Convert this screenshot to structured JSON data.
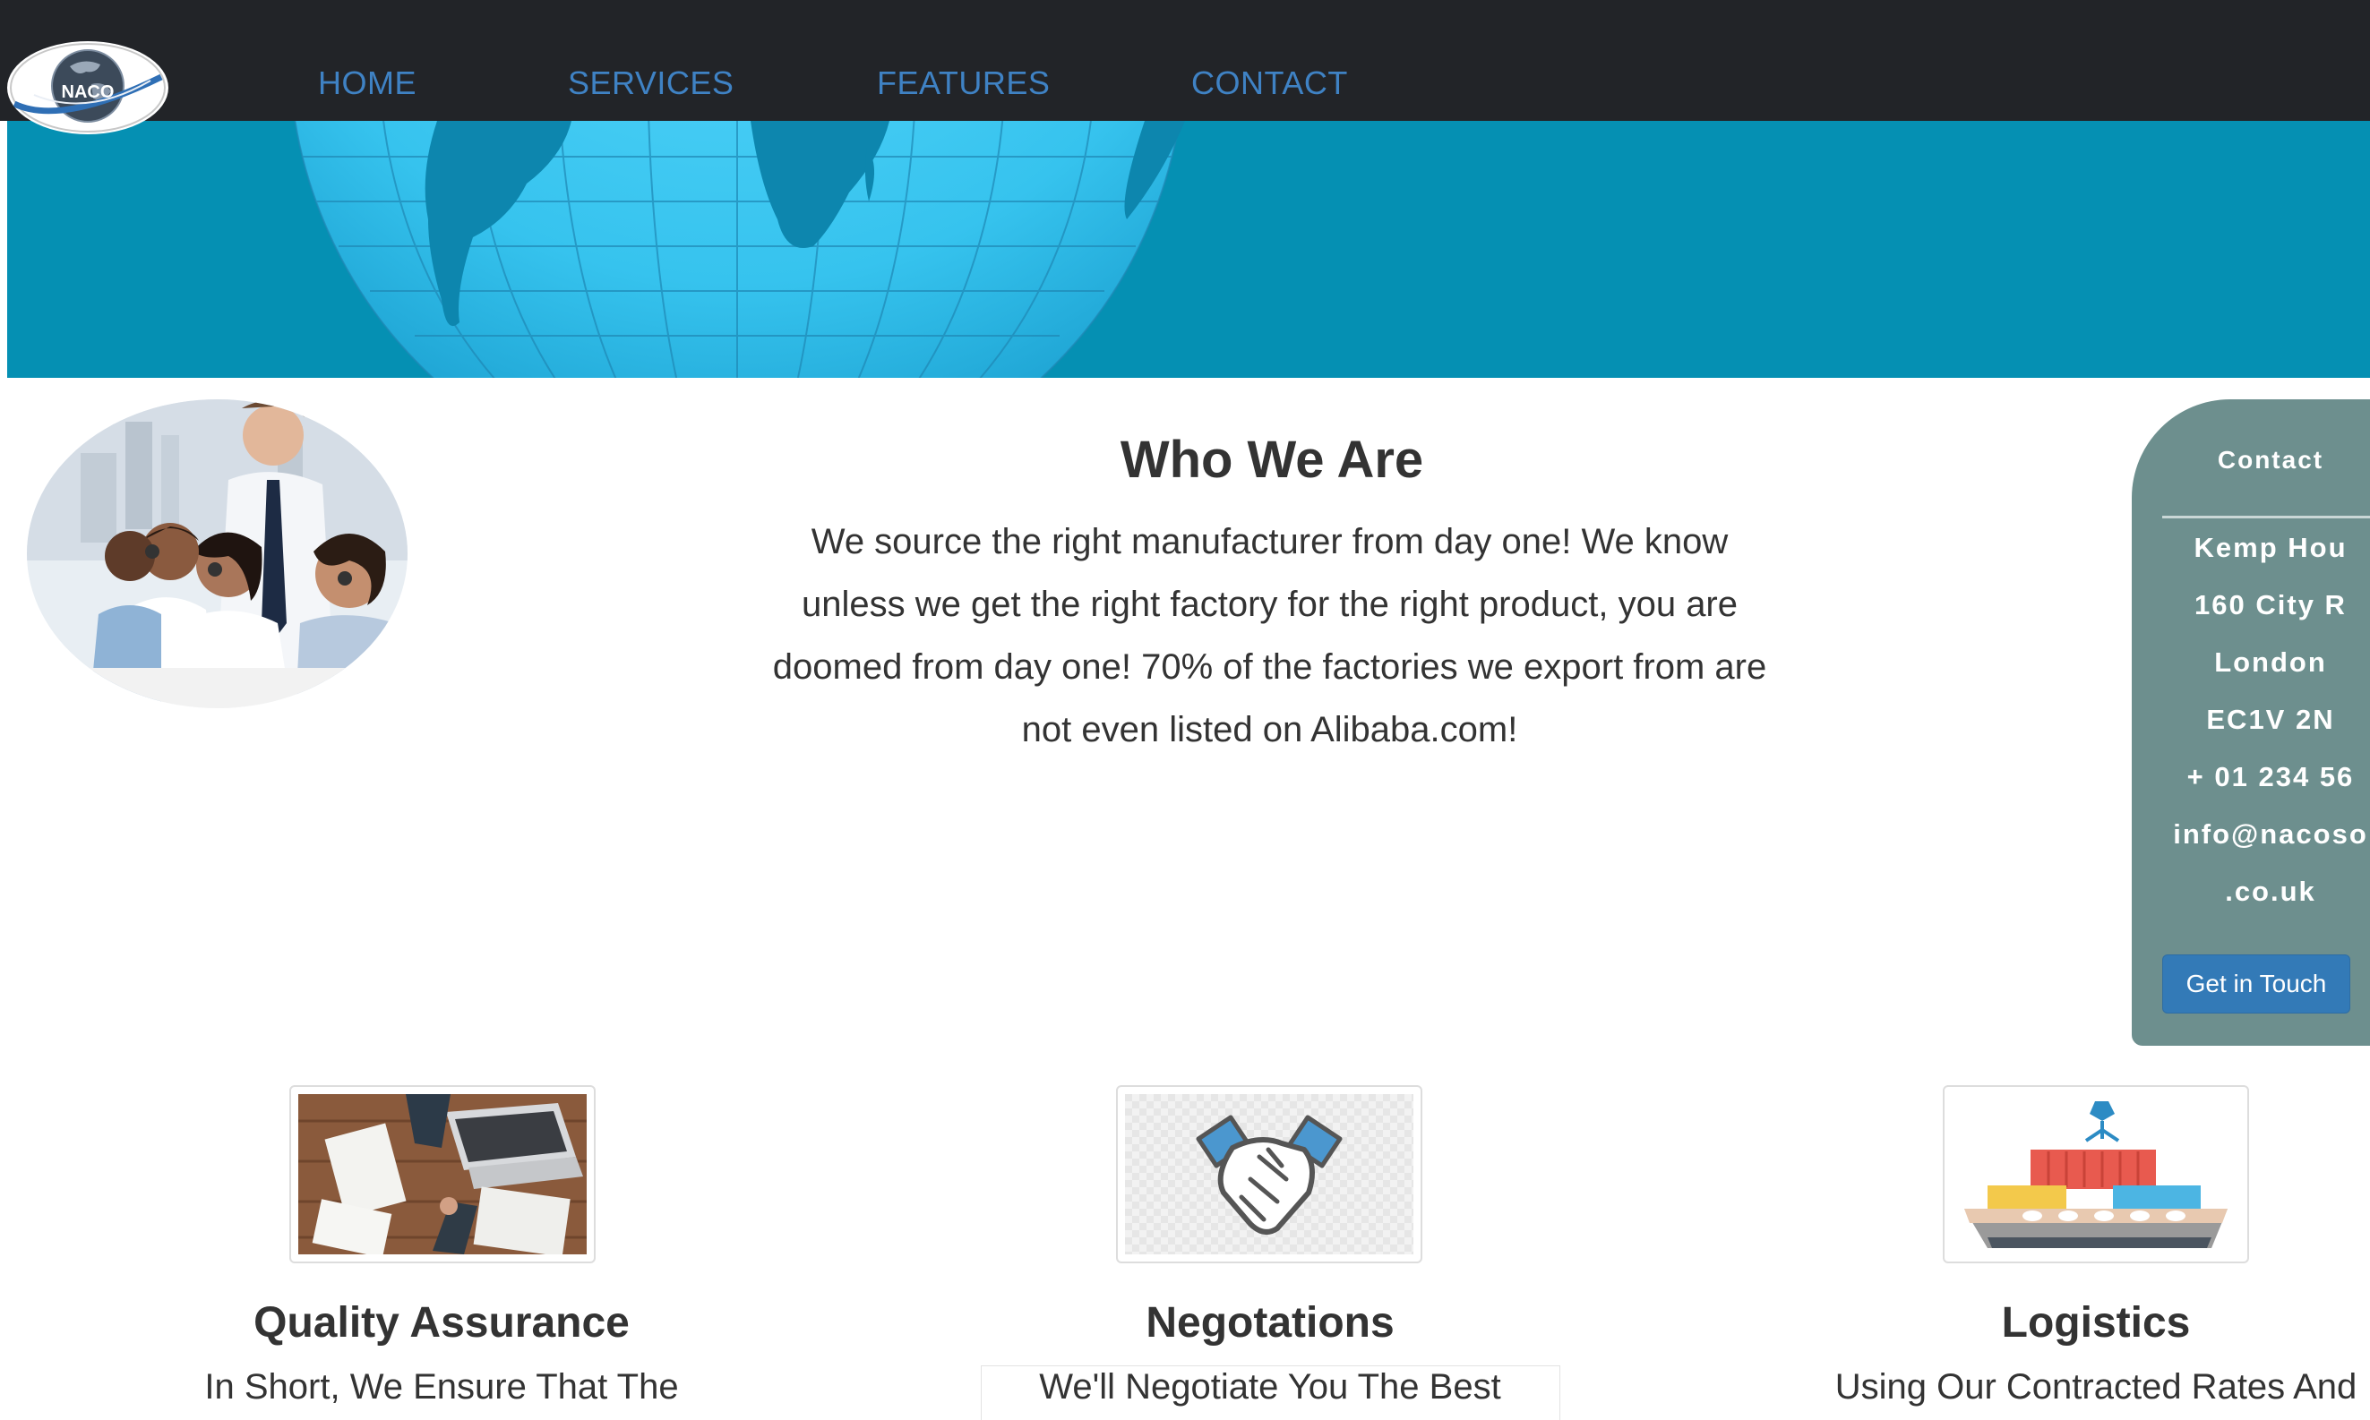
{
  "nav": {
    "logo_text": "NACO",
    "items": [
      {
        "label": "HOME"
      },
      {
        "label": "SERVICES"
      },
      {
        "label": "FEATURES"
      },
      {
        "label": "CONTACT"
      }
    ],
    "link_color": "#3f82c4",
    "bar_color": "#222428"
  },
  "hero": {
    "background_color": "#0590b3",
    "image": "globe-image"
  },
  "intro": {
    "image": "call-center-team-photo",
    "title": "Who We Are",
    "text": "We source the right manufacturer from day one! We know unless we get the right factory for the right product, you are doomed from day one! 70% of the factories we export from are not even listed on Alibaba.com!"
  },
  "contact": {
    "heading": "Contact",
    "address": [
      "Kemp Hou",
      "160 City R",
      "London",
      "EC1V 2N",
      "+ 01 234 56",
      "info@nacoso",
      ".co.uk"
    ],
    "button_label": "Get in Touch",
    "card_color": "#6d8f8e",
    "button_color": "#337ab7"
  },
  "services": [
    {
      "image": "business-meeting-photo",
      "title": "Quality Assurance",
      "text": "In Short, We Ensure That The"
    },
    {
      "image": "handshake-icon",
      "title": "Negotations",
      "text": "We'll Negotiate You The Best"
    },
    {
      "image": "cargo-ship-icon",
      "title": "Logistics",
      "text": "Using Our Contracted Rates And"
    }
  ]
}
